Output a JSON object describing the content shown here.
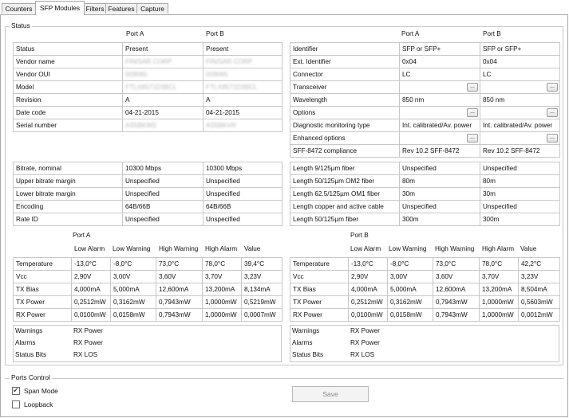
{
  "tabs": [
    "Counters",
    "SFP Modules",
    "Filters",
    "Features",
    "Capture"
  ],
  "status": {
    "title": "Status",
    "left_headers": [
      "Port A",
      "Port B"
    ],
    "left_rows": [
      [
        "Status",
        "Present",
        "Present"
      ],
      [
        "Vendor name",
        "FINISAR CORP",
        "FINISAR CORP"
      ],
      [
        "Vendor OUI",
        "009065",
        "009065"
      ],
      [
        "Model",
        "FTLX8571D3BCL",
        "FTLX8571D3BCL"
      ],
      [
        "Revision",
        "A",
        "A"
      ],
      [
        "Date code",
        "04-21-2015",
        "04-21-2015"
      ],
      [
        "Serial number",
        "AS5BKW0",
        "AS5BKVR"
      ]
    ],
    "right_headers": [
      "Port A",
      "Port B"
    ],
    "right_rows": [
      [
        "Identifier",
        "SFP or SFP+",
        "SFP or SFP+"
      ],
      [
        "Ext. Identifier",
        "0x04",
        "0x04"
      ],
      [
        "Connector",
        "LC",
        "LC"
      ],
      [
        "Transceiver",
        "",
        ""
      ],
      [
        "Wavelength",
        "850 nm",
        "850 nm"
      ],
      [
        "Options",
        "",
        ""
      ],
      [
        "Diagnostic monitoring type",
        "Int. calibrated/Av. power",
        "Int. calibrated/Av. power"
      ],
      [
        "Enhanced options",
        "",
        ""
      ],
      [
        "SFF-8472 compliance",
        "Rev 10.2 SFF-8472",
        "Rev 10.2 SFF-8472"
      ]
    ],
    "ellipsis": "...",
    "left_rates": [
      [
        "Bitrate, nominal",
        "10300 Mbps",
        "10300 Mbps"
      ],
      [
        "Upper bitrate margin",
        "Unspecified",
        "Unspecified"
      ],
      [
        "Lower bitrate margin",
        "Unspecified",
        "Unspecified"
      ],
      [
        "Encoding",
        "64B/66B",
        "64B/66B"
      ],
      [
        "Rate ID",
        "Unspecified",
        "Unspecified"
      ]
    ],
    "right_lengths": [
      [
        "Length 9/125µm fiber",
        "Unspecified",
        "Unspecified"
      ],
      [
        "Length 50/125µm OM2 fiber",
        "80m",
        "80m"
      ],
      [
        "Length 62.5/125µm OM1 fiber",
        "30m",
        "30m"
      ],
      [
        "Length copper and active cable",
        "Unspecified",
        "Unspecified"
      ],
      [
        "Length 50/125µm fiber",
        "300m",
        "300m"
      ]
    ],
    "diag_headers": [
      "Low Alarm",
      "Low Warning",
      "High Warning",
      "High Alarm",
      "Value"
    ],
    "port_a": {
      "label": "Port A",
      "rows": [
        [
          "Temperature",
          "-13,0°C",
          "-8,0°C",
          "73,0°C",
          "78,0°C",
          "39,4°C"
        ],
        [
          "Vcc",
          "2,90V",
          "3,00V",
          "3,60V",
          "3,70V",
          "3,23V"
        ],
        [
          "TX Bias",
          "4,000mA",
          "5,000mA",
          "12,600mA",
          "13,200mA",
          "8,134mA"
        ],
        [
          "TX Power",
          "0,2512mW",
          "0,3162mW",
          "0,7943mW",
          "1,0000mW",
          "0,5219mW"
        ],
        [
          "RX Power",
          "0,0100mW",
          "0,0158mW",
          "0,7943mW",
          "1,0000mW",
          "0,0007mW"
        ]
      ],
      "flags": [
        [
          "Warnings",
          "RX Power"
        ],
        [
          "Alarms",
          "RX Power"
        ],
        [
          "Status Bits",
          "RX LOS"
        ]
      ]
    },
    "port_b": {
      "label": "Port B",
      "rows": [
        [
          "Temperature",
          "-13,0°C",
          "-8,0°C",
          "73,0°C",
          "78,0°C",
          "42,2°C"
        ],
        [
          "Vcc",
          "2,90V",
          "3,00V",
          "3,60V",
          "3,70V",
          "3,23V"
        ],
        [
          "TX Bias",
          "4,000mA",
          "5,000mA",
          "12,600mA",
          "13,200mA",
          "8,504mA"
        ],
        [
          "TX Power",
          "0,2512mW",
          "0,3162mW",
          "0,7943mW",
          "1,0000mW",
          "0,5603mW"
        ],
        [
          "RX Power",
          "0,0100mW",
          "0,0158mW",
          "0,7943mW",
          "1,0000mW",
          "0,0012mW"
        ]
      ],
      "flags": [
        [
          "Warnings",
          "RX Power"
        ],
        [
          "Alarms",
          "RX Power"
        ],
        [
          "Status Bits",
          "RX LOS"
        ]
      ]
    }
  },
  "ports_control": {
    "title": "Ports Control",
    "span_mode": "Span Mode",
    "span_mode_checked": true,
    "loopback": "Loopback",
    "loopback_checked": false,
    "save": "Save"
  }
}
